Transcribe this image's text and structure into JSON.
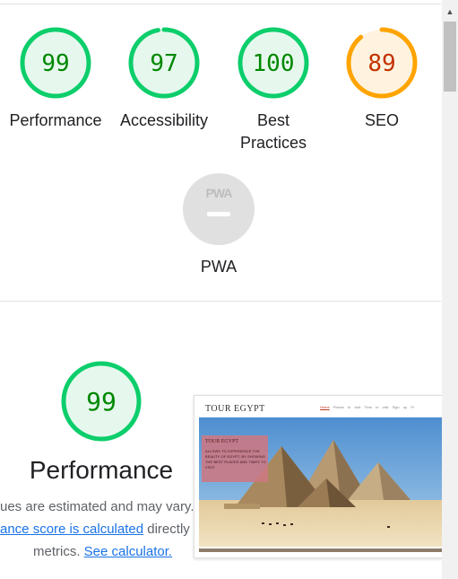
{
  "gauges": [
    {
      "score": "99",
      "label": "Performance",
      "fraction": 0.99,
      "color": "#0cce6b",
      "text_color": "#008800",
      "fill": "#e6f8ee"
    },
    {
      "score": "97",
      "label": "Accessibility",
      "fraction": 0.97,
      "color": "#0cce6b",
      "text_color": "#008800",
      "fill": "#e6f8ee"
    },
    {
      "score": "100",
      "label_line1": "Best",
      "label_line2": "Practices",
      "fraction": 1.0,
      "color": "#0cce6b",
      "text_color": "#008800",
      "fill": "#e6f8ee"
    },
    {
      "score": "89",
      "label": "SEO",
      "fraction": 0.89,
      "color": "#ffa400",
      "text_color": "#c33300",
      "fill": "#fff3e0"
    }
  ],
  "pwa": {
    "badge_text": "PWA",
    "label": "PWA"
  },
  "performance": {
    "score": "99",
    "fraction": 0.99,
    "title": "Performance",
    "desc_line1": "ues are estimated and may vary.",
    "desc_link1": "ance score is calculated",
    "desc_line2_rest": " directly fr",
    "desc_line3": "metrics. ",
    "desc_link2": "See calculator."
  },
  "screenshot": {
    "brand": "TOUR EGYPT",
    "nav": [
      "Home",
      "Places to visit",
      "Time to visit",
      "Sign up",
      "Pr"
    ],
    "card_title": "TOUR EGYPT",
    "card_body": "ALLOWS TO EXPERIENCE THE BEAUTY OF EGYPT, BY SHOWING THE BEST PLACES AND TIMES TO VISIT"
  },
  "scrollbar": {
    "up_arrow": "▲"
  }
}
